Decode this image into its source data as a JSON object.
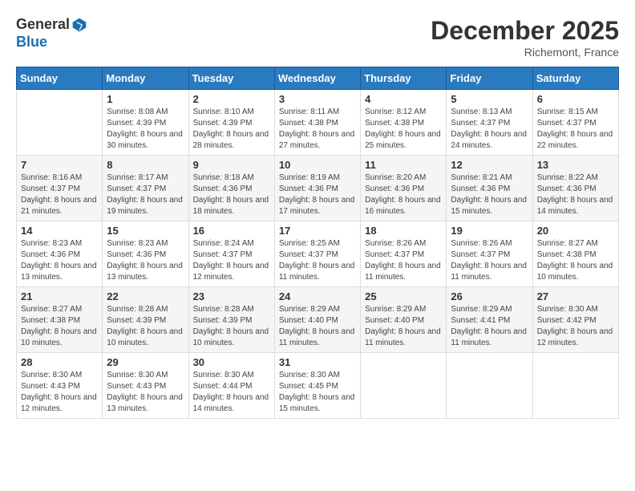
{
  "header": {
    "logo_line1": "General",
    "logo_line2": "Blue",
    "month_title": "December 2025",
    "location": "Richemont, France"
  },
  "days_of_week": [
    "Sunday",
    "Monday",
    "Tuesday",
    "Wednesday",
    "Thursday",
    "Friday",
    "Saturday"
  ],
  "weeks": [
    [
      {
        "day": "",
        "sunrise": "",
        "sunset": "",
        "daylight": ""
      },
      {
        "day": "1",
        "sunrise": "Sunrise: 8:08 AM",
        "sunset": "Sunset: 4:39 PM",
        "daylight": "Daylight: 8 hours and 30 minutes."
      },
      {
        "day": "2",
        "sunrise": "Sunrise: 8:10 AM",
        "sunset": "Sunset: 4:39 PM",
        "daylight": "Daylight: 8 hours and 28 minutes."
      },
      {
        "day": "3",
        "sunrise": "Sunrise: 8:11 AM",
        "sunset": "Sunset: 4:38 PM",
        "daylight": "Daylight: 8 hours and 27 minutes."
      },
      {
        "day": "4",
        "sunrise": "Sunrise: 8:12 AM",
        "sunset": "Sunset: 4:38 PM",
        "daylight": "Daylight: 8 hours and 25 minutes."
      },
      {
        "day": "5",
        "sunrise": "Sunrise: 8:13 AM",
        "sunset": "Sunset: 4:37 PM",
        "daylight": "Daylight: 8 hours and 24 minutes."
      },
      {
        "day": "6",
        "sunrise": "Sunrise: 8:15 AM",
        "sunset": "Sunset: 4:37 PM",
        "daylight": "Daylight: 8 hours and 22 minutes."
      }
    ],
    [
      {
        "day": "7",
        "sunrise": "Sunrise: 8:16 AM",
        "sunset": "Sunset: 4:37 PM",
        "daylight": "Daylight: 8 hours and 21 minutes."
      },
      {
        "day": "8",
        "sunrise": "Sunrise: 8:17 AM",
        "sunset": "Sunset: 4:37 PM",
        "daylight": "Daylight: 8 hours and 19 minutes."
      },
      {
        "day": "9",
        "sunrise": "Sunrise: 8:18 AM",
        "sunset": "Sunset: 4:36 PM",
        "daylight": "Daylight: 8 hours and 18 minutes."
      },
      {
        "day": "10",
        "sunrise": "Sunrise: 8:19 AM",
        "sunset": "Sunset: 4:36 PM",
        "daylight": "Daylight: 8 hours and 17 minutes."
      },
      {
        "day": "11",
        "sunrise": "Sunrise: 8:20 AM",
        "sunset": "Sunset: 4:36 PM",
        "daylight": "Daylight: 8 hours and 16 minutes."
      },
      {
        "day": "12",
        "sunrise": "Sunrise: 8:21 AM",
        "sunset": "Sunset: 4:36 PM",
        "daylight": "Daylight: 8 hours and 15 minutes."
      },
      {
        "day": "13",
        "sunrise": "Sunrise: 8:22 AM",
        "sunset": "Sunset: 4:36 PM",
        "daylight": "Daylight: 8 hours and 14 minutes."
      }
    ],
    [
      {
        "day": "14",
        "sunrise": "Sunrise: 8:23 AM",
        "sunset": "Sunset: 4:36 PM",
        "daylight": "Daylight: 8 hours and 13 minutes."
      },
      {
        "day": "15",
        "sunrise": "Sunrise: 8:23 AM",
        "sunset": "Sunset: 4:36 PM",
        "daylight": "Daylight: 8 hours and 13 minutes."
      },
      {
        "day": "16",
        "sunrise": "Sunrise: 8:24 AM",
        "sunset": "Sunset: 4:37 PM",
        "daylight": "Daylight: 8 hours and 12 minutes."
      },
      {
        "day": "17",
        "sunrise": "Sunrise: 8:25 AM",
        "sunset": "Sunset: 4:37 PM",
        "daylight": "Daylight: 8 hours and 11 minutes."
      },
      {
        "day": "18",
        "sunrise": "Sunrise: 8:26 AM",
        "sunset": "Sunset: 4:37 PM",
        "daylight": "Daylight: 8 hours and 11 minutes."
      },
      {
        "day": "19",
        "sunrise": "Sunrise: 8:26 AM",
        "sunset": "Sunset: 4:37 PM",
        "daylight": "Daylight: 8 hours and 11 minutes."
      },
      {
        "day": "20",
        "sunrise": "Sunrise: 8:27 AM",
        "sunset": "Sunset: 4:38 PM",
        "daylight": "Daylight: 8 hours and 10 minutes."
      }
    ],
    [
      {
        "day": "21",
        "sunrise": "Sunrise: 8:27 AM",
        "sunset": "Sunset: 4:38 PM",
        "daylight": "Daylight: 8 hours and 10 minutes."
      },
      {
        "day": "22",
        "sunrise": "Sunrise: 8:28 AM",
        "sunset": "Sunset: 4:39 PM",
        "daylight": "Daylight: 8 hours and 10 minutes."
      },
      {
        "day": "23",
        "sunrise": "Sunrise: 8:28 AM",
        "sunset": "Sunset: 4:39 PM",
        "daylight": "Daylight: 8 hours and 10 minutes."
      },
      {
        "day": "24",
        "sunrise": "Sunrise: 8:29 AM",
        "sunset": "Sunset: 4:40 PM",
        "daylight": "Daylight: 8 hours and 11 minutes."
      },
      {
        "day": "25",
        "sunrise": "Sunrise: 8:29 AM",
        "sunset": "Sunset: 4:40 PM",
        "daylight": "Daylight: 8 hours and 11 minutes."
      },
      {
        "day": "26",
        "sunrise": "Sunrise: 8:29 AM",
        "sunset": "Sunset: 4:41 PM",
        "daylight": "Daylight: 8 hours and 11 minutes."
      },
      {
        "day": "27",
        "sunrise": "Sunrise: 8:30 AM",
        "sunset": "Sunset: 4:42 PM",
        "daylight": "Daylight: 8 hours and 12 minutes."
      }
    ],
    [
      {
        "day": "28",
        "sunrise": "Sunrise: 8:30 AM",
        "sunset": "Sunset: 4:43 PM",
        "daylight": "Daylight: 8 hours and 12 minutes."
      },
      {
        "day": "29",
        "sunrise": "Sunrise: 8:30 AM",
        "sunset": "Sunset: 4:43 PM",
        "daylight": "Daylight: 8 hours and 13 minutes."
      },
      {
        "day": "30",
        "sunrise": "Sunrise: 8:30 AM",
        "sunset": "Sunset: 4:44 PM",
        "daylight": "Daylight: 8 hours and 14 minutes."
      },
      {
        "day": "31",
        "sunrise": "Sunrise: 8:30 AM",
        "sunset": "Sunset: 4:45 PM",
        "daylight": "Daylight: 8 hours and 15 minutes."
      },
      {
        "day": "",
        "sunrise": "",
        "sunset": "",
        "daylight": ""
      },
      {
        "day": "",
        "sunrise": "",
        "sunset": "",
        "daylight": ""
      },
      {
        "day": "",
        "sunrise": "",
        "sunset": "",
        "daylight": ""
      }
    ]
  ]
}
